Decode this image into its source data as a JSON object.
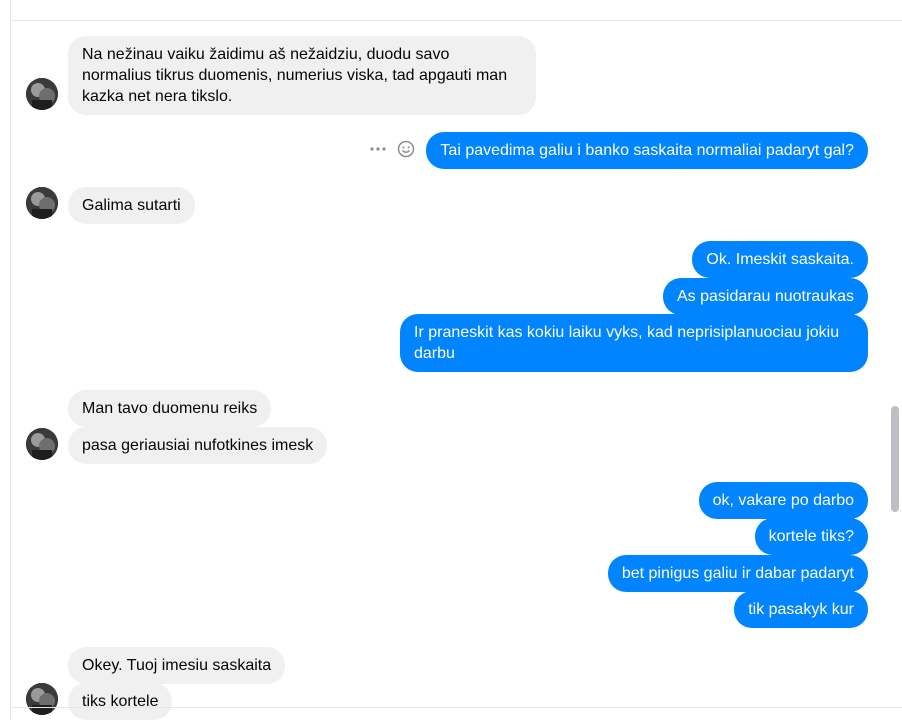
{
  "messages": [
    {
      "side": "in",
      "text": "Na nežinau vaiku žaidimu aš nežaidziu, duodu savo normalius tikrus duomenis, numerius viska, tad apgauti man kazka net nera tikslo."
    },
    {
      "side": "out",
      "text": "Tai pavedima galiu i banko saskaita normaliai padaryt gal?"
    },
    {
      "side": "in",
      "text": "Galima sutarti"
    },
    {
      "side": "out",
      "text": "Ok. Imeskit saskaita."
    },
    {
      "side": "out",
      "text": "As pasidarau nuotraukas"
    },
    {
      "side": "out",
      "text": "Ir praneskit kas kokiu laiku vyks, kad neprisiplanuociau jokiu darbu"
    },
    {
      "side": "in",
      "text": "Man tavo duomenu reiks"
    },
    {
      "side": "in",
      "text": "pasa geriausiai nufotkines imesk"
    },
    {
      "side": "out",
      "text": "ok, vakare po darbo"
    },
    {
      "side": "out",
      "text": "kortele tiks?"
    },
    {
      "side": "out",
      "text": "bet pinigus galiu ir dabar padaryt"
    },
    {
      "side": "out",
      "text": "tik pasakyk kur"
    },
    {
      "side": "in",
      "text": "Okey. Tuoj imesiu saskaita"
    },
    {
      "side": "in",
      "text": "tiks kortele"
    }
  ],
  "message_actions": {
    "more_icon": "more-horizontal-icon",
    "react_icon": "smiley-icon"
  },
  "colors": {
    "outgoing_bubble": "#0084ff",
    "incoming_bubble": "#f0f0f0"
  }
}
